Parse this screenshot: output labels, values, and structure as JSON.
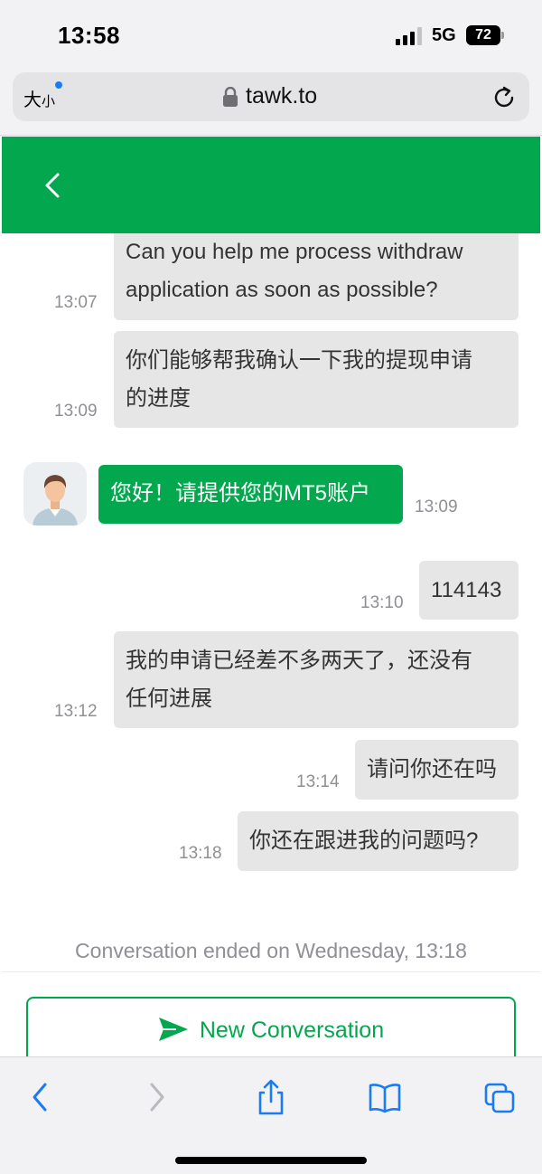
{
  "status_bar": {
    "time": "13:58",
    "network": "5G",
    "battery": "72"
  },
  "browser": {
    "text_size_label": "大",
    "text_size_small": "小",
    "url": "tawk.to"
  },
  "chat": {
    "messages": [
      {
        "text_line1": "Can you help me process withdraw",
        "text_line2": "application as soon as possible?",
        "time": "13:07",
        "sender": "visitor"
      },
      {
        "text_line1": "你们能够帮我确认一下我的提现申请",
        "text_line2": "的进度",
        "time": "13:09",
        "sender": "visitor"
      },
      {
        "text": "您好！请提供您的MT5账户",
        "time": "13:09",
        "sender": "agent"
      },
      {
        "text": "114143",
        "time": "13:10",
        "sender": "visitor"
      },
      {
        "text_line1": "我的申请已经差不多两天了，还没有",
        "text_line2": "任何进展",
        "time": "13:12",
        "sender": "visitor"
      },
      {
        "text": "请问你还在吗",
        "time": "13:14",
        "sender": "visitor"
      },
      {
        "text": "你还在跟进我的问题吗?",
        "time": "13:18",
        "sender": "visitor"
      }
    ],
    "ended_notice": "Conversation ended on Wednesday, 13:18",
    "new_conversation_label": "New Conversation"
  },
  "icons": {
    "back": "chevron-left-icon",
    "send": "send-icon",
    "lock": "lock-icon",
    "reload": "reload-icon",
    "share": "share-icon",
    "bookmarks": "book-icon",
    "tabs": "tabs-icon"
  },
  "colors": {
    "brand": "#03a84e",
    "visitor_bubble": "#e6e6e6",
    "ios_blue": "#1a7cf5"
  }
}
